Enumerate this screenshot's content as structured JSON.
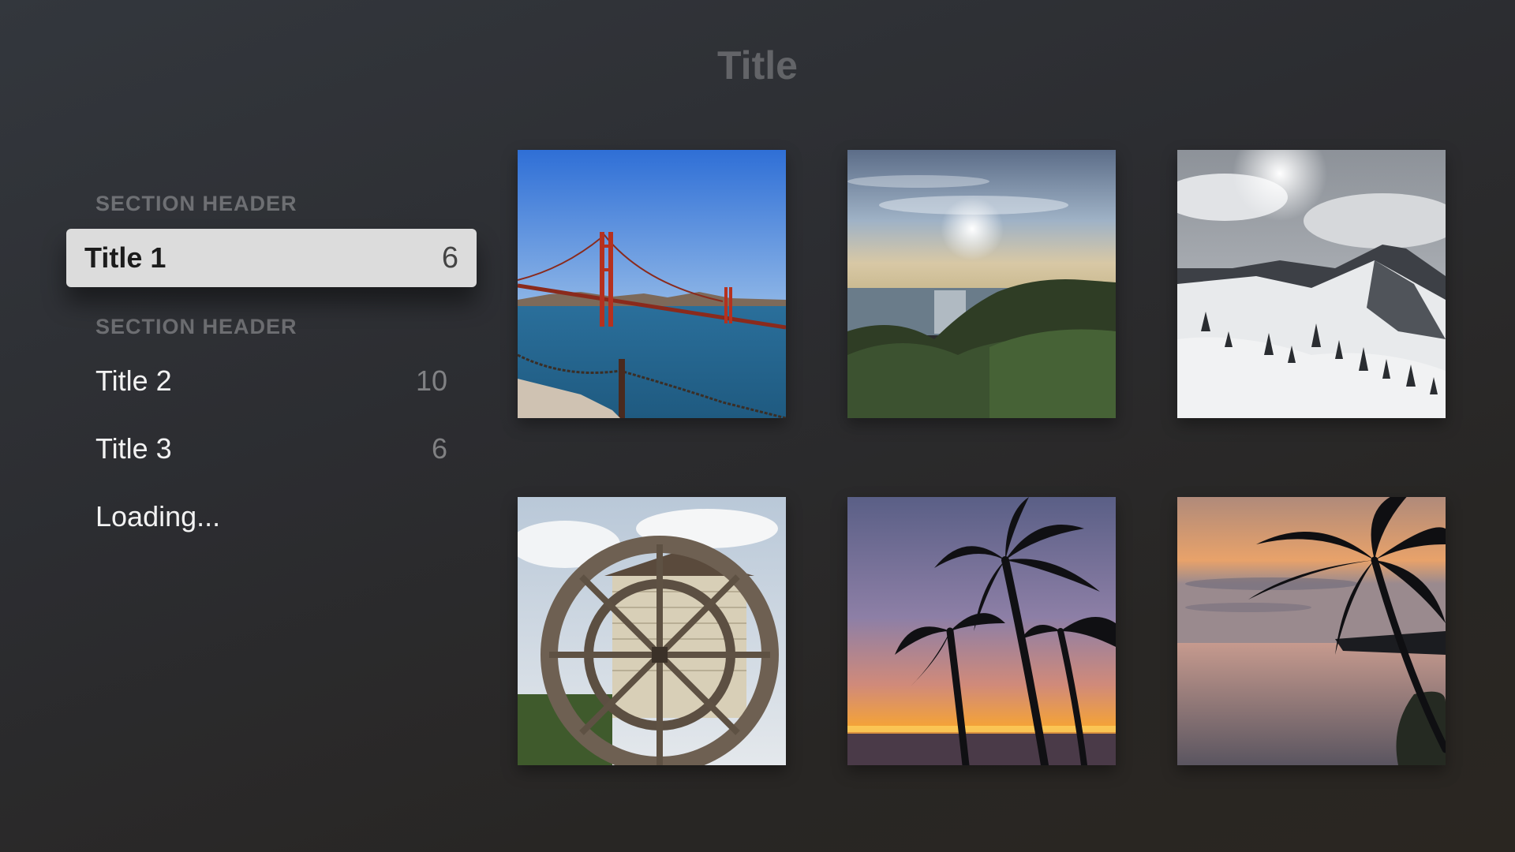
{
  "header": {
    "title": "Title"
  },
  "sidebar": {
    "sections": [
      {
        "header": "SECTION HEADER",
        "items": [
          {
            "label": "Title 1",
            "count": "6",
            "focused": true
          }
        ]
      },
      {
        "header": "SECTION HEADER",
        "items": [
          {
            "label": "Title 2",
            "count": "10",
            "focused": false
          },
          {
            "label": "Title 3",
            "count": "6",
            "focused": false
          },
          {
            "label": "Loading...",
            "count": "",
            "focused": false
          }
        ]
      }
    ]
  },
  "grid": {
    "photos": [
      {
        "subject": "golden-gate-bridge"
      },
      {
        "subject": "ocean-sunset-coast"
      },
      {
        "subject": "snowy-mountain"
      },
      {
        "subject": "water-wheel"
      },
      {
        "subject": "palm-trees-sunset"
      },
      {
        "subject": "palm-tree-beach"
      }
    ]
  },
  "colors": {
    "focused_row_bg": "#dcdcdc",
    "section_header": "#6a6c70",
    "text": "#f2f2f2"
  }
}
